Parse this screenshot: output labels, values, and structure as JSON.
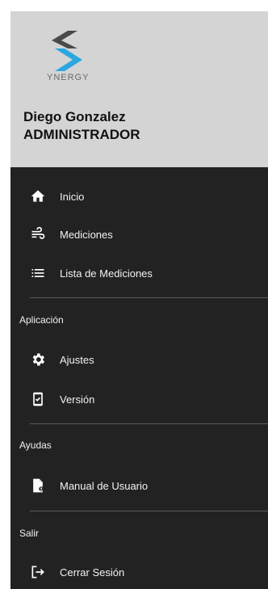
{
  "header": {
    "logo_text": "YNERGY",
    "user_name": "Diego Gonzalez",
    "user_role": "ADMINISTRADOR"
  },
  "menu": {
    "inicio": "Inicio",
    "mediciones": "Mediciones",
    "lista_mediciones": "Lista de Mediciones"
  },
  "sections": {
    "aplicacion": "Aplicación",
    "ayudas": "Ayudas",
    "salir": "Salir"
  },
  "aplicacion_items": {
    "ajustes": "Ajustes",
    "version": "Versión"
  },
  "ayudas_items": {
    "manual": "Manual de Usuario"
  },
  "salir_items": {
    "cerrar_sesion": "Cerrar Sesión"
  },
  "colors": {
    "drawer_bg": "#222222",
    "header_bg": "#d4d4d4",
    "logo_dark": "#4a4a4a",
    "logo_blue": "#2aa7e0"
  }
}
